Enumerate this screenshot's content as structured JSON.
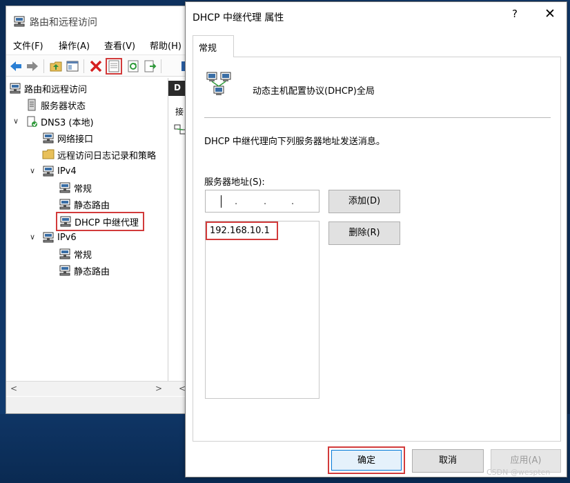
{
  "mmc": {
    "title": "路由和远程访问",
    "menu": [
      "文件(F)",
      "操作(A)",
      "查看(V)",
      "帮助(H)"
    ],
    "tree": {
      "root": "路由和远程访问",
      "server_status": "服务器状态",
      "server": "DNS3 (本地)",
      "network_interfaces": "网络接口",
      "remote_access_logging": "远程访问日志记录和策略",
      "ipv4": "IPv4",
      "ipv4_general": "常规",
      "ipv4_static_routes": "静态路由",
      "ipv4_dhcp_relay": "DHCP 中继代理",
      "ipv6": "IPv6",
      "ipv6_general": "常规",
      "ipv6_static_routes": "静态路由"
    },
    "right_pane": {
      "header": "D",
      "column_text": "接"
    }
  },
  "dialog": {
    "title": "DHCP 中继代理 属性",
    "help_glyph": "?",
    "close_glyph": "✕",
    "tab_general": "常规",
    "heading": "动态主机配置协议(DHCP)全局",
    "description": "DHCP 中继代理向下列服务器地址发送消息。",
    "server_address_label": "服务器地址(S):",
    "ip_dots": [
      ".",
      ".",
      "."
    ],
    "add_button": "添加(D)",
    "remove_button": "删除(R)",
    "server_list": [
      "192.168.10.1"
    ],
    "ok_button": "确定",
    "cancel_button": "取消",
    "apply_button": "应用(A)"
  },
  "watermark": "CSDN @wespten",
  "colors": {
    "highlight_red": "#d23a3a",
    "primary_blue": "#0078d7",
    "button_gray": "#e1e1e1"
  },
  "icons": {
    "app": "routing-server-icon",
    "back": "arrow-left-icon",
    "forward": "arrow-right-icon",
    "up": "folder-up-icon",
    "show_hide": "console-tree-icon",
    "delete": "delete-x-icon",
    "properties": "properties-icon",
    "refresh": "refresh-icon",
    "export": "export-list-icon"
  }
}
